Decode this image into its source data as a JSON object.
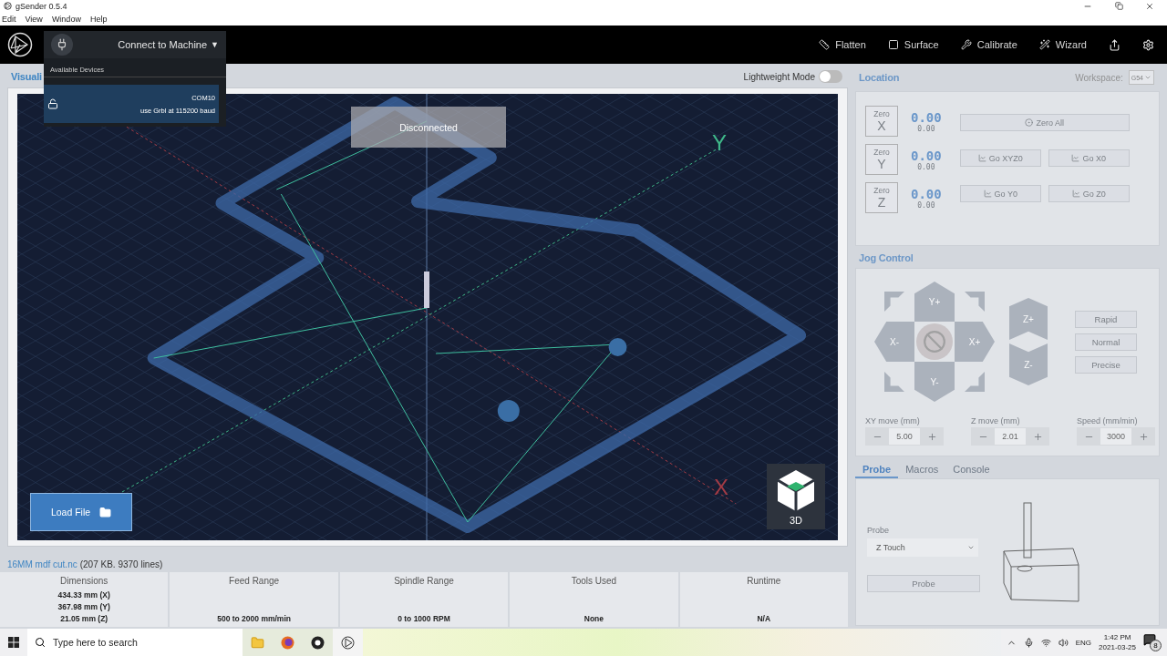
{
  "window": {
    "title": "gSender 0.5.4"
  },
  "menu": [
    {
      "label": "Edit"
    },
    {
      "label": "View"
    },
    {
      "label": "Window"
    },
    {
      "label": "Help"
    }
  ],
  "toolbar": {
    "connect": {
      "label": "Connect to Machine",
      "caret": "▼",
      "expanded": true
    },
    "items": [
      {
        "label": "Flatten"
      },
      {
        "label": "Surface"
      },
      {
        "label": "Calibrate"
      },
      {
        "label": "Wizard"
      }
    ]
  },
  "device_menu": {
    "heading": "Available Devices",
    "devices": [
      {
        "port": "COM10",
        "detail": "use Grbl at 115200 baud",
        "selected": true
      }
    ]
  },
  "visualizer": {
    "title": "Visuali",
    "lightweight_mode": {
      "label": "Lightweight Mode",
      "on": false
    },
    "status": "Disconnected",
    "axis_labels": [
      "Y",
      "X"
    ],
    "load_button": "Load File",
    "view_button": "3D"
  },
  "file": {
    "name": "16MM mdf cut.nc",
    "info": "(207 KB. 9370 lines)"
  },
  "stats": [
    {
      "label": "Dimensions",
      "values": [
        "434.33 mm (X)",
        "367.98 mm (Y)",
        "21.05 mm (Z)"
      ]
    },
    {
      "label": "Feed Range",
      "values": [
        "500 to 2000 mm/min"
      ]
    },
    {
      "label": "Spindle Range",
      "values": [
        "0 to 1000 RPM"
      ]
    },
    {
      "label": "Tools Used",
      "values": [
        "None"
      ]
    },
    {
      "label": "Runtime",
      "values": [
        "N/A"
      ]
    }
  ],
  "controls": {
    "disabled": true,
    "location": {
      "title": "Location",
      "workspace_label": "Workspace:",
      "workspace": "G54",
      "axes": [
        {
          "zero": "Zero",
          "axis": "X",
          "value": "0.00",
          "machine": "0.00"
        },
        {
          "zero": "Zero",
          "axis": "Y",
          "value": "0.00",
          "machine": "0.00"
        },
        {
          "zero": "Zero",
          "axis": "Z",
          "value": "0.00",
          "machine": "0.00"
        }
      ],
      "zero_all": "Zero All",
      "go_buttons": [
        "Go XYZ0",
        "Go X0",
        "Go Y0",
        "Go Z0"
      ]
    },
    "jog": {
      "title": "Jog Control",
      "xy": {
        "y_plus": "Y+",
        "x_minus": "X-",
        "x_plus": "X+",
        "y_minus": "Y-"
      },
      "z": [
        "Z+",
        "Z-"
      ],
      "presets": [
        {
          "label": "Rapid"
        },
        {
          "label": "Normal"
        },
        {
          "label": "Precise"
        }
      ],
      "steppers": [
        {
          "label": "XY move (mm)",
          "value": "5.00"
        },
        {
          "label": "Z move (mm)",
          "value": "2.01"
        },
        {
          "label": "Speed (mm/min)",
          "value": "3000"
        }
      ]
    },
    "tabs": [
      {
        "label": "Probe",
        "selected": true
      },
      {
        "label": "Macros",
        "selected": false
      },
      {
        "label": "Console",
        "selected": false
      }
    ],
    "probe": {
      "field_label": "Probe",
      "value": "Z Touch",
      "button": "Probe"
    }
  },
  "taskbar": {
    "search_placeholder": "Type here to search",
    "language": "ENG",
    "time": "1:42 PM",
    "date": "2021-03-25",
    "notifications": "8"
  }
}
